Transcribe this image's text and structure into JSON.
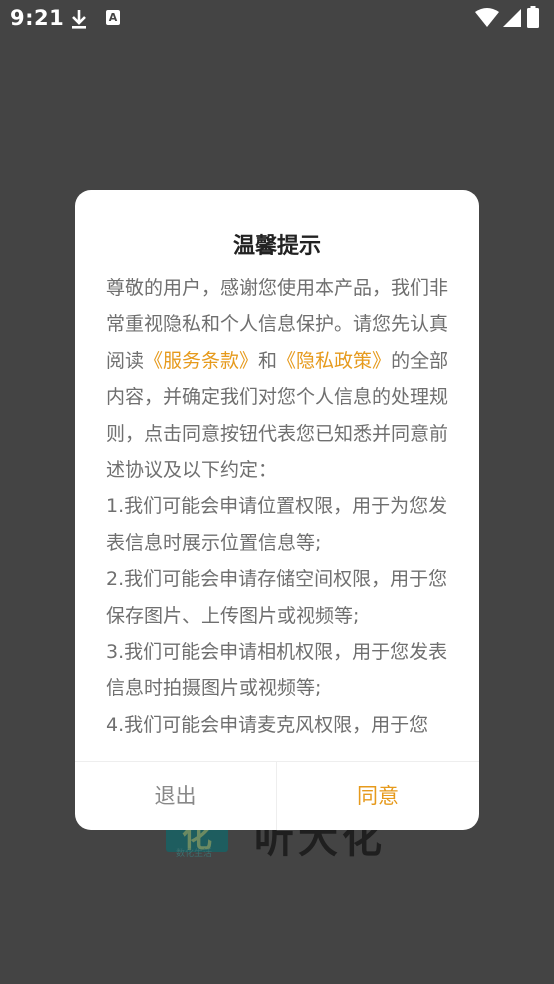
{
  "status_bar": {
    "time": "9:21",
    "notification_icons": [
      "download-icon",
      "a-icon"
    ],
    "a_glyph": "A",
    "system_icons": [
      "wifi-icon",
      "signal-icon",
      "battery-icon"
    ]
  },
  "background": {
    "logo_mark": "化",
    "logo_caption": "数化生活",
    "brand_text": "听大化"
  },
  "dialog": {
    "title": "温馨提示",
    "intro_1": "尊敬的用户，感谢您使用本产品，我们非常重视隐私和个人信息保护。请您先认真阅读",
    "terms_link": "《服务条款》",
    "and_text": "和",
    "privacy_link": "《隐私政策》",
    "intro_2": "的全部内容，并确定我们对您个人信息的处理规则，点击同意按钮代表您已知悉并同意前述协议及以下约定：",
    "items": [
      "1.我们可能会申请位置权限，用于为您发表信息时展示位置信息等;",
      "2.我们可能会申请存储空间权限，用于您保存图片、上传图片或视频等;",
      "3.我们可能会申请相机权限，用于您发表信息时拍摄图片或视频等;",
      "4.我们可能会申请麦克风权限，用于您"
    ],
    "exit_label": "退出",
    "agree_label": "同意"
  },
  "colors": {
    "accent": "#e69a1c",
    "overlay": "#444444",
    "body_text": "#6f6f6f"
  }
}
